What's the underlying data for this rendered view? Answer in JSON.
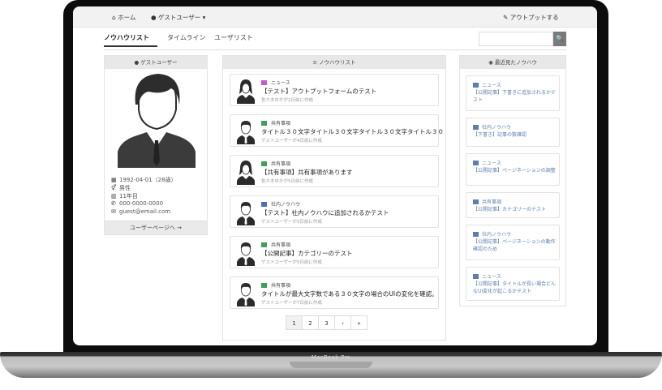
{
  "device": {
    "brand": "MacBook Pro"
  },
  "topbar": {
    "home": "ホーム",
    "user": "ゲストユーザー ▾",
    "output": "アウトプットする"
  },
  "tabs": [
    "ノウハウリスト",
    "タイムライン",
    "ユーザリスト"
  ],
  "search": {
    "button": "🔍",
    "placeholder": ""
  },
  "profile": {
    "header": "ゲストユーザー",
    "info": [
      "1992-04-01（28歳）",
      "男性",
      "11年目",
      "000-0000-0000",
      "guest@email.com"
    ],
    "user_page_button": "ユーザーページへ →"
  },
  "list": {
    "header": "ノウハウリスト",
    "items": [
      {
        "category": "ニュース",
        "badge_color": "#c45cc6",
        "title": "【テスト】アウトプットフォームのテスト",
        "meta": "佐々木ゆかが2日前に作成",
        "avatar": "female"
      },
      {
        "category": "共有事項",
        "badge_color": "#3aa05a",
        "title": "タイトル３０文字タイトル３０文字タイトル３０文字タイトル３０",
        "meta": "ゲストユーザーが4日前に作成",
        "avatar": "male"
      },
      {
        "category": "共有事項",
        "badge_color": "#3aa05a",
        "title": "【共有事項】共有事項があります",
        "meta": "佐々木ゆかが5日前に作成",
        "avatar": "female"
      },
      {
        "category": "社内ノウハウ",
        "badge_color": "#4a6fc0",
        "title": "【テスト】社内ノウハウに追加されるかテスト",
        "meta": "ゲストユーザーが5日前に作成",
        "avatar": "male"
      },
      {
        "category": "共有事項",
        "badge_color": "#3aa05a",
        "title": "【公開記事】カテゴリーのテスト",
        "meta": "ゲストユーザーが5日前に作成",
        "avatar": "male"
      },
      {
        "category": "共有事項",
        "badge_color": "#3aa05a",
        "title": "タイトルが最大文字数である３０文字の場合のUIの変化を確認。",
        "meta": "ゲストユーザーが7日前に作成",
        "avatar": "male"
      }
    ],
    "pagination": [
      "1",
      "2",
      "3",
      "›",
      "»"
    ],
    "current_page": "1"
  },
  "recent": {
    "header": "最近見たノウハウ",
    "items": [
      {
        "category": "ニュース",
        "title": "【公開記事】下書きに追加されるかテスト"
      },
      {
        "category": "社内ノウハウ",
        "title": "【下書き】記事の数確認"
      },
      {
        "category": "ニュース",
        "title": "【公開記事】ページネーションの調整"
      },
      {
        "category": "共有事項",
        "title": "【公開記事】カテゴリーのテスト"
      },
      {
        "category": "社内ノウハウ",
        "title": "【公開記事】ページネーションの動作確認のため"
      },
      {
        "category": "ニュース",
        "title": "【公開記事】タイトルが長い場合どんなUI変化が起こるかテスト"
      }
    ]
  },
  "colors": {
    "accent": "#5b7fb0",
    "search_button": "#7a7a7a"
  }
}
